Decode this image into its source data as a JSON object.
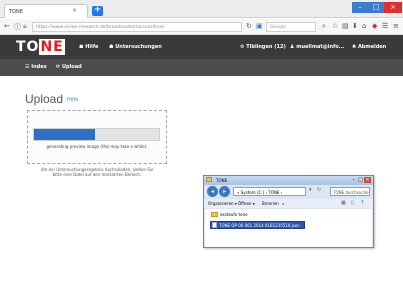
{
  "browser": {
    "tab_title": "TONE",
    "tab_close": "×",
    "new_tab": "+",
    "url": "https://www.vision-research.de/broadmaster/access/lines",
    "search_placeholder": "Google",
    "window_controls": [
      "–",
      "□",
      "×"
    ]
  },
  "navbar": {
    "logo_prefix": "TO",
    "logo_highlight": "NE",
    "items": [
      {
        "label": "Hilfe",
        "icon": "help-icon"
      },
      {
        "label": "Untersuchungen",
        "icon": "list-icon"
      }
    ],
    "right_items": [
      {
        "label": "Tiblingen (12)",
        "icon": "bell-icon"
      },
      {
        "label": "muellmat@info...",
        "icon": "user-icon"
      },
      {
        "label": "Abmelden",
        "icon": "close-icon"
      }
    ]
  },
  "subnav": {
    "items": [
      {
        "label": "Index"
      },
      {
        "label": "Upload"
      }
    ]
  },
  "page": {
    "title": "Upload",
    "help_link": "Hilfe",
    "progress_text": "generating preview image (this may take a while).",
    "progress_fraction": 0.49,
    "hint_line1": "Um ein Untersuchungsergebnis hochzuladen, ziehen Sie",
    "hint_line2": "bitte eine Datei auf den markierten Bereich."
  },
  "explorer": {
    "title": "TONE",
    "address": "« System (C:) › TONE ›",
    "search_placeholder": "TONE durchsuchen",
    "toolbar_items": [
      "Organisieren ▾",
      "Öffnen ▾",
      "Brennen",
      "»"
    ],
    "folder_name": "exsteufe tone",
    "selected_file": "TONE OP 00 061 2014 0161235510.json"
  },
  "colors": {
    "navbar": "#3a3a3a",
    "subnav": "#4c4c4c",
    "logo_red": "#e21d1d",
    "progress": "#2e6fc4",
    "link": "#3a8fd0"
  }
}
